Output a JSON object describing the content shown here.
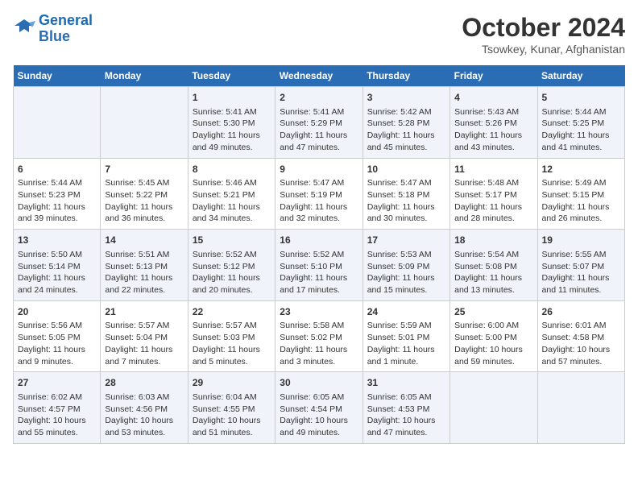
{
  "header": {
    "logo_line1": "General",
    "logo_line2": "Blue",
    "month": "October 2024",
    "location": "Tsowkey, Kunar, Afghanistan"
  },
  "columns": [
    "Sunday",
    "Monday",
    "Tuesday",
    "Wednesday",
    "Thursday",
    "Friday",
    "Saturday"
  ],
  "rows": [
    [
      {
        "day": "",
        "info": ""
      },
      {
        "day": "",
        "info": ""
      },
      {
        "day": "1",
        "info": "Sunrise: 5:41 AM\nSunset: 5:30 PM\nDaylight: 11 hours and 49 minutes."
      },
      {
        "day": "2",
        "info": "Sunrise: 5:41 AM\nSunset: 5:29 PM\nDaylight: 11 hours and 47 minutes."
      },
      {
        "day": "3",
        "info": "Sunrise: 5:42 AM\nSunset: 5:28 PM\nDaylight: 11 hours and 45 minutes."
      },
      {
        "day": "4",
        "info": "Sunrise: 5:43 AM\nSunset: 5:26 PM\nDaylight: 11 hours and 43 minutes."
      },
      {
        "day": "5",
        "info": "Sunrise: 5:44 AM\nSunset: 5:25 PM\nDaylight: 11 hours and 41 minutes."
      }
    ],
    [
      {
        "day": "6",
        "info": "Sunrise: 5:44 AM\nSunset: 5:23 PM\nDaylight: 11 hours and 39 minutes."
      },
      {
        "day": "7",
        "info": "Sunrise: 5:45 AM\nSunset: 5:22 PM\nDaylight: 11 hours and 36 minutes."
      },
      {
        "day": "8",
        "info": "Sunrise: 5:46 AM\nSunset: 5:21 PM\nDaylight: 11 hours and 34 minutes."
      },
      {
        "day": "9",
        "info": "Sunrise: 5:47 AM\nSunset: 5:19 PM\nDaylight: 11 hours and 32 minutes."
      },
      {
        "day": "10",
        "info": "Sunrise: 5:47 AM\nSunset: 5:18 PM\nDaylight: 11 hours and 30 minutes."
      },
      {
        "day": "11",
        "info": "Sunrise: 5:48 AM\nSunset: 5:17 PM\nDaylight: 11 hours and 28 minutes."
      },
      {
        "day": "12",
        "info": "Sunrise: 5:49 AM\nSunset: 5:15 PM\nDaylight: 11 hours and 26 minutes."
      }
    ],
    [
      {
        "day": "13",
        "info": "Sunrise: 5:50 AM\nSunset: 5:14 PM\nDaylight: 11 hours and 24 minutes."
      },
      {
        "day": "14",
        "info": "Sunrise: 5:51 AM\nSunset: 5:13 PM\nDaylight: 11 hours and 22 minutes."
      },
      {
        "day": "15",
        "info": "Sunrise: 5:52 AM\nSunset: 5:12 PM\nDaylight: 11 hours and 20 minutes."
      },
      {
        "day": "16",
        "info": "Sunrise: 5:52 AM\nSunset: 5:10 PM\nDaylight: 11 hours and 17 minutes."
      },
      {
        "day": "17",
        "info": "Sunrise: 5:53 AM\nSunset: 5:09 PM\nDaylight: 11 hours and 15 minutes."
      },
      {
        "day": "18",
        "info": "Sunrise: 5:54 AM\nSunset: 5:08 PM\nDaylight: 11 hours and 13 minutes."
      },
      {
        "day": "19",
        "info": "Sunrise: 5:55 AM\nSunset: 5:07 PM\nDaylight: 11 hours and 11 minutes."
      }
    ],
    [
      {
        "day": "20",
        "info": "Sunrise: 5:56 AM\nSunset: 5:05 PM\nDaylight: 11 hours and 9 minutes."
      },
      {
        "day": "21",
        "info": "Sunrise: 5:57 AM\nSunset: 5:04 PM\nDaylight: 11 hours and 7 minutes."
      },
      {
        "day": "22",
        "info": "Sunrise: 5:57 AM\nSunset: 5:03 PM\nDaylight: 11 hours and 5 minutes."
      },
      {
        "day": "23",
        "info": "Sunrise: 5:58 AM\nSunset: 5:02 PM\nDaylight: 11 hours and 3 minutes."
      },
      {
        "day": "24",
        "info": "Sunrise: 5:59 AM\nSunset: 5:01 PM\nDaylight: 11 hours and 1 minute."
      },
      {
        "day": "25",
        "info": "Sunrise: 6:00 AM\nSunset: 5:00 PM\nDaylight: 10 hours and 59 minutes."
      },
      {
        "day": "26",
        "info": "Sunrise: 6:01 AM\nSunset: 4:58 PM\nDaylight: 10 hours and 57 minutes."
      }
    ],
    [
      {
        "day": "27",
        "info": "Sunrise: 6:02 AM\nSunset: 4:57 PM\nDaylight: 10 hours and 55 minutes."
      },
      {
        "day": "28",
        "info": "Sunrise: 6:03 AM\nSunset: 4:56 PM\nDaylight: 10 hours and 53 minutes."
      },
      {
        "day": "29",
        "info": "Sunrise: 6:04 AM\nSunset: 4:55 PM\nDaylight: 10 hours and 51 minutes."
      },
      {
        "day": "30",
        "info": "Sunrise: 6:05 AM\nSunset: 4:54 PM\nDaylight: 10 hours and 49 minutes."
      },
      {
        "day": "31",
        "info": "Sunrise: 6:05 AM\nSunset: 4:53 PM\nDaylight: 10 hours and 47 minutes."
      },
      {
        "day": "",
        "info": ""
      },
      {
        "day": "",
        "info": ""
      }
    ]
  ]
}
